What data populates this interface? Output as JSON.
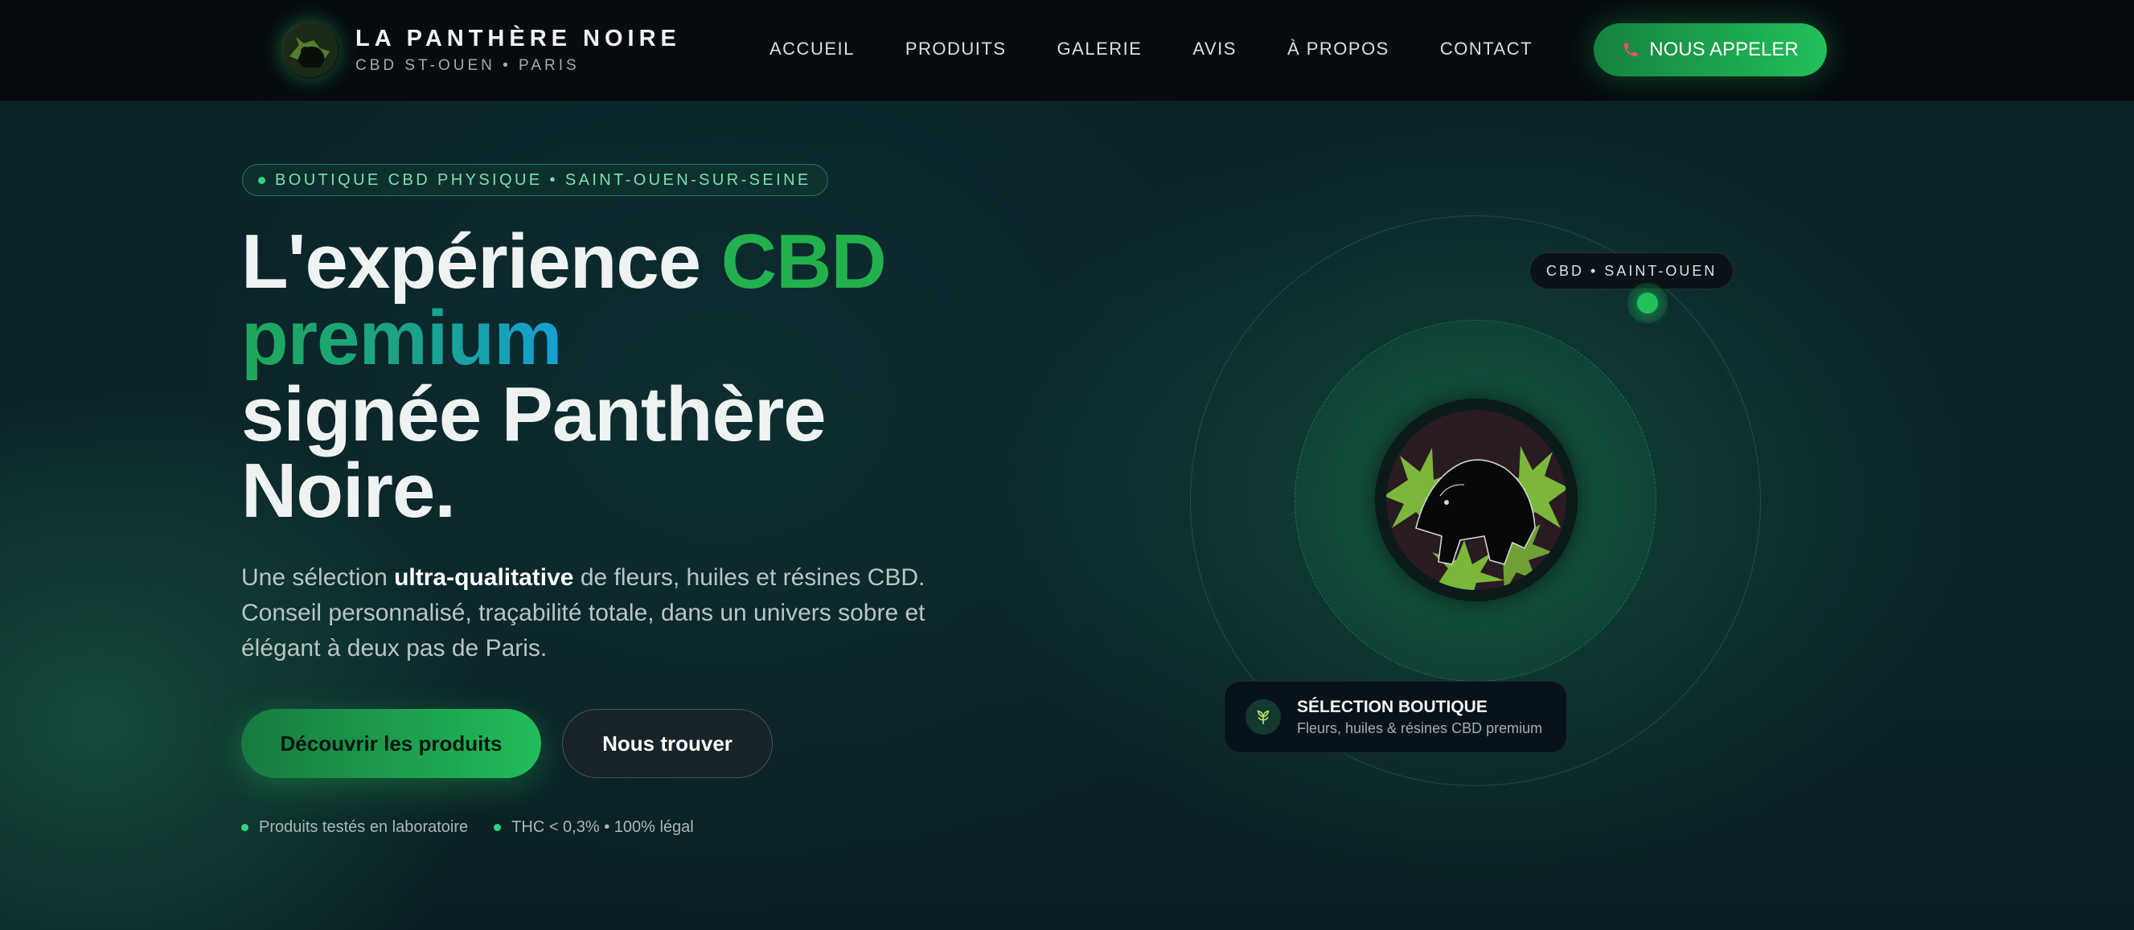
{
  "brand": {
    "name": "LA PANTHÈRE NOIRE",
    "subtitle": "CBD ST-OUEN • PARIS",
    "logo_icon": "panther-logo-icon"
  },
  "nav": {
    "items": [
      {
        "label": "ACCUEIL"
      },
      {
        "label": "PRODUITS"
      },
      {
        "label": "GALERIE"
      },
      {
        "label": "AVIS"
      },
      {
        "label": "À PROPOS"
      },
      {
        "label": "CONTACT"
      }
    ],
    "call_button": {
      "label": "NOUS APPELER",
      "icon": "phone-icon"
    }
  },
  "hero": {
    "badge": "BOUTIQUE CBD PHYSIQUE • SAINT-OUEN-SUR-SEINE",
    "headline": {
      "part1": "L'expérience ",
      "accent": "CBD",
      "gradient": "premium",
      "part2": "signée Panthère Noire."
    },
    "lead": {
      "before": "Une sélection ",
      "strong": "ultra-qualitative",
      "after": " de fleurs, huiles et résines CBD. Conseil personnalisé, traçabilité totale, dans un univers sobre et élégant à deux pas de Paris."
    },
    "buttons": {
      "primary": "Découvrir les produits",
      "secondary": "Nous trouver"
    },
    "features": [
      "Produits testés en laboratoire",
      "THC < 0,3% • 100% légal"
    ]
  },
  "visual": {
    "tag": "CBD • SAINT-OUEN",
    "card": {
      "title": "SÉLECTION BOUTIQUE",
      "subtitle": "Fleurs, huiles & résines CBD premium",
      "icon": "leaf-icon"
    },
    "center_icon": "panther-logo-icon"
  },
  "colors": {
    "accent_green": "#22c05a",
    "nav_bg": "#060b10",
    "page_bg": "#0b2327",
    "gradient_blue": "#16a0d4"
  }
}
